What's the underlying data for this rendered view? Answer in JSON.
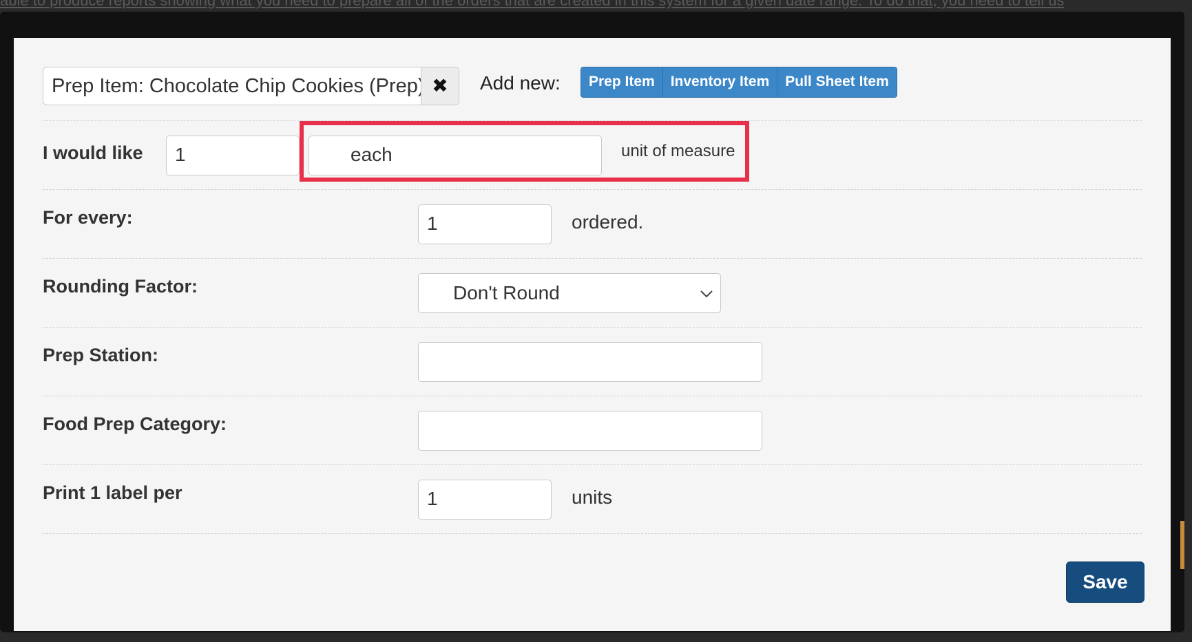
{
  "background": {
    "top_text": "able to produce reports showing what you need to prepare all of the orders that are created in this system for a given date range. To do that, you need to tell us",
    "bottom_text": "... ... ... ..."
  },
  "header": {
    "selected_item": "Prep Item: Chocolate Chip Cookies (Prep)",
    "clear_icon": "✖",
    "add_new_label": "Add new:",
    "add_buttons": [
      "Prep Item",
      "Inventory Item",
      "Pull Sheet Item"
    ]
  },
  "form": {
    "would_like": {
      "label": "I would like",
      "quantity": "1",
      "unit": "each",
      "unit_suffix": "unit of measure"
    },
    "for_every": {
      "label": "For every:",
      "value": "1",
      "suffix": "ordered."
    },
    "rounding": {
      "label": "Rounding Factor:",
      "selected": "Don't Round"
    },
    "prep_station": {
      "label": "Prep Station:",
      "value": ""
    },
    "food_prep_category": {
      "label": "Food Prep Category:",
      "value": ""
    },
    "print_label": {
      "label": "Print 1 label per",
      "value": "1",
      "suffix": "units"
    }
  },
  "footer": {
    "save_label": "Save"
  },
  "colors": {
    "primary_button": "#3b87c8",
    "save_button": "#174d7e",
    "highlight": "#e8304a"
  }
}
